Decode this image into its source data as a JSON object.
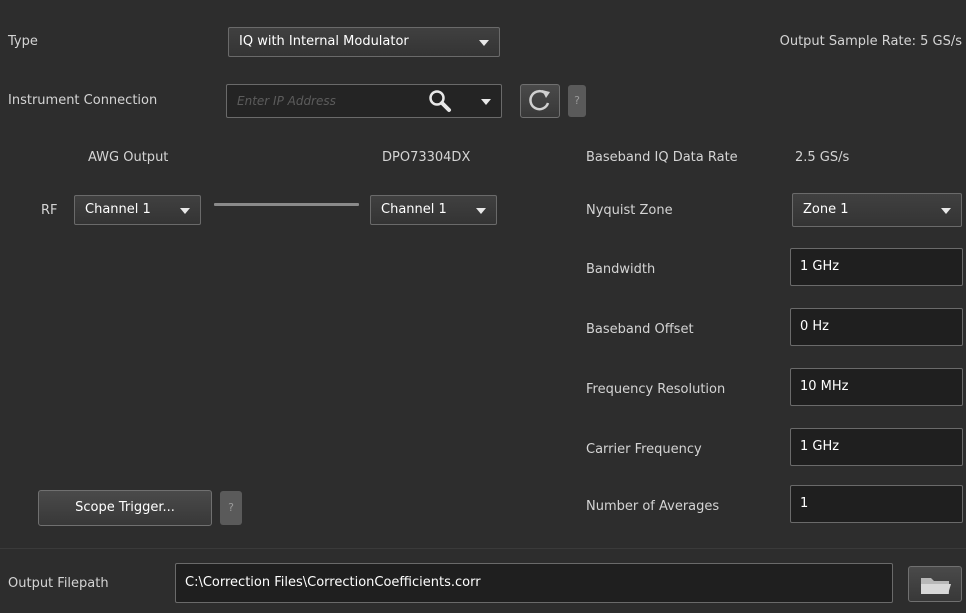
{
  "type": {
    "label": "Type",
    "value": "IQ with Internal Modulator"
  },
  "output_sample_rate": {
    "label": "Output Sample Rate:",
    "value": "5 GS/s"
  },
  "instrument_connection": {
    "label": "Instrument Connection",
    "placeholder": "Enter IP Address"
  },
  "help_label": "?",
  "awg_output": {
    "heading": "AWG Output",
    "rf_label": "RF",
    "channel": "Channel 1"
  },
  "scope": {
    "heading": "DPO73304DX",
    "channel": "Channel 1"
  },
  "baseband_iq": {
    "label": "Baseband IQ Data Rate",
    "value": "2.5 GS/s"
  },
  "params": {
    "nyquist": {
      "label": "Nyquist Zone",
      "value": "Zone 1"
    },
    "bandwidth": {
      "label": "Bandwidth",
      "value": "1 GHz"
    },
    "baseband_offset": {
      "label": "Baseband Offset",
      "value": "0 Hz"
    },
    "freq_resolution": {
      "label": "Frequency Resolution",
      "value": "10 MHz"
    },
    "carrier_freq": {
      "label": "Carrier Frequency",
      "value": "1 GHz"
    },
    "num_averages": {
      "label": "Number of Averages",
      "value": "1"
    }
  },
  "scope_trigger": {
    "label": "Scope Trigger..."
  },
  "output_filepath": {
    "label": "Output Filepath",
    "value": "C:\\Correction Files\\CorrectionCoefficients.corr"
  },
  "icons": [
    "search-icon",
    "dropdown-arrow-icon",
    "refresh-icon",
    "help-icon",
    "folder-icon"
  ]
}
